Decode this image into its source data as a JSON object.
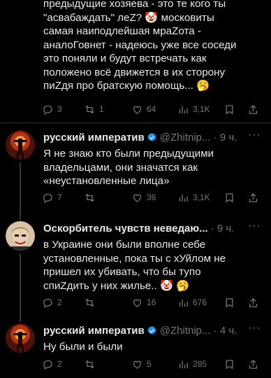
{
  "tweets": [
    {
      "text": "предыдущие хозяева - это те кого ты\n\"асвабаждать\" леZ? 🤡 московиты\nсамая наиподлейшая мраZота -\nаналоГовнет - надеюсь уже все соседи\nэто поняли и будут встречать как\nположено всё движется в их сторону\nпиZдя про братскую помощь... 🥱",
      "replies": "3",
      "reposts": "1",
      "likes": "64",
      "views": "3,1K"
    },
    {
      "name": "русский императив",
      "handle": "@Zhitnip... · 9 ч.",
      "text": "Я не знаю кто были предыдущими\nвладельцами, они значатся как\n«неустановленные лица»",
      "replies": "7",
      "reposts": "",
      "likes": "36",
      "views": "3,1K"
    },
    {
      "name": "Оскорбитель чувств неведаю...",
      "handle": "· 9 ч.",
      "text": "в Украине они были вполне себе\nустановленные, пока ты с хУйлом не\nпришел их убивать, что бы тупо\nспиZдить у них жилье.. 🤡 🥱",
      "replies": "2",
      "reposts": "",
      "likes": "16",
      "views": "676"
    },
    {
      "name": "русский императив",
      "handle": "@Zhitnip... · 4 ч.",
      "text": "Ну были и были",
      "replies": "2",
      "reposts": "",
      "likes": "5",
      "views": "285"
    }
  ],
  "more_label": "···"
}
